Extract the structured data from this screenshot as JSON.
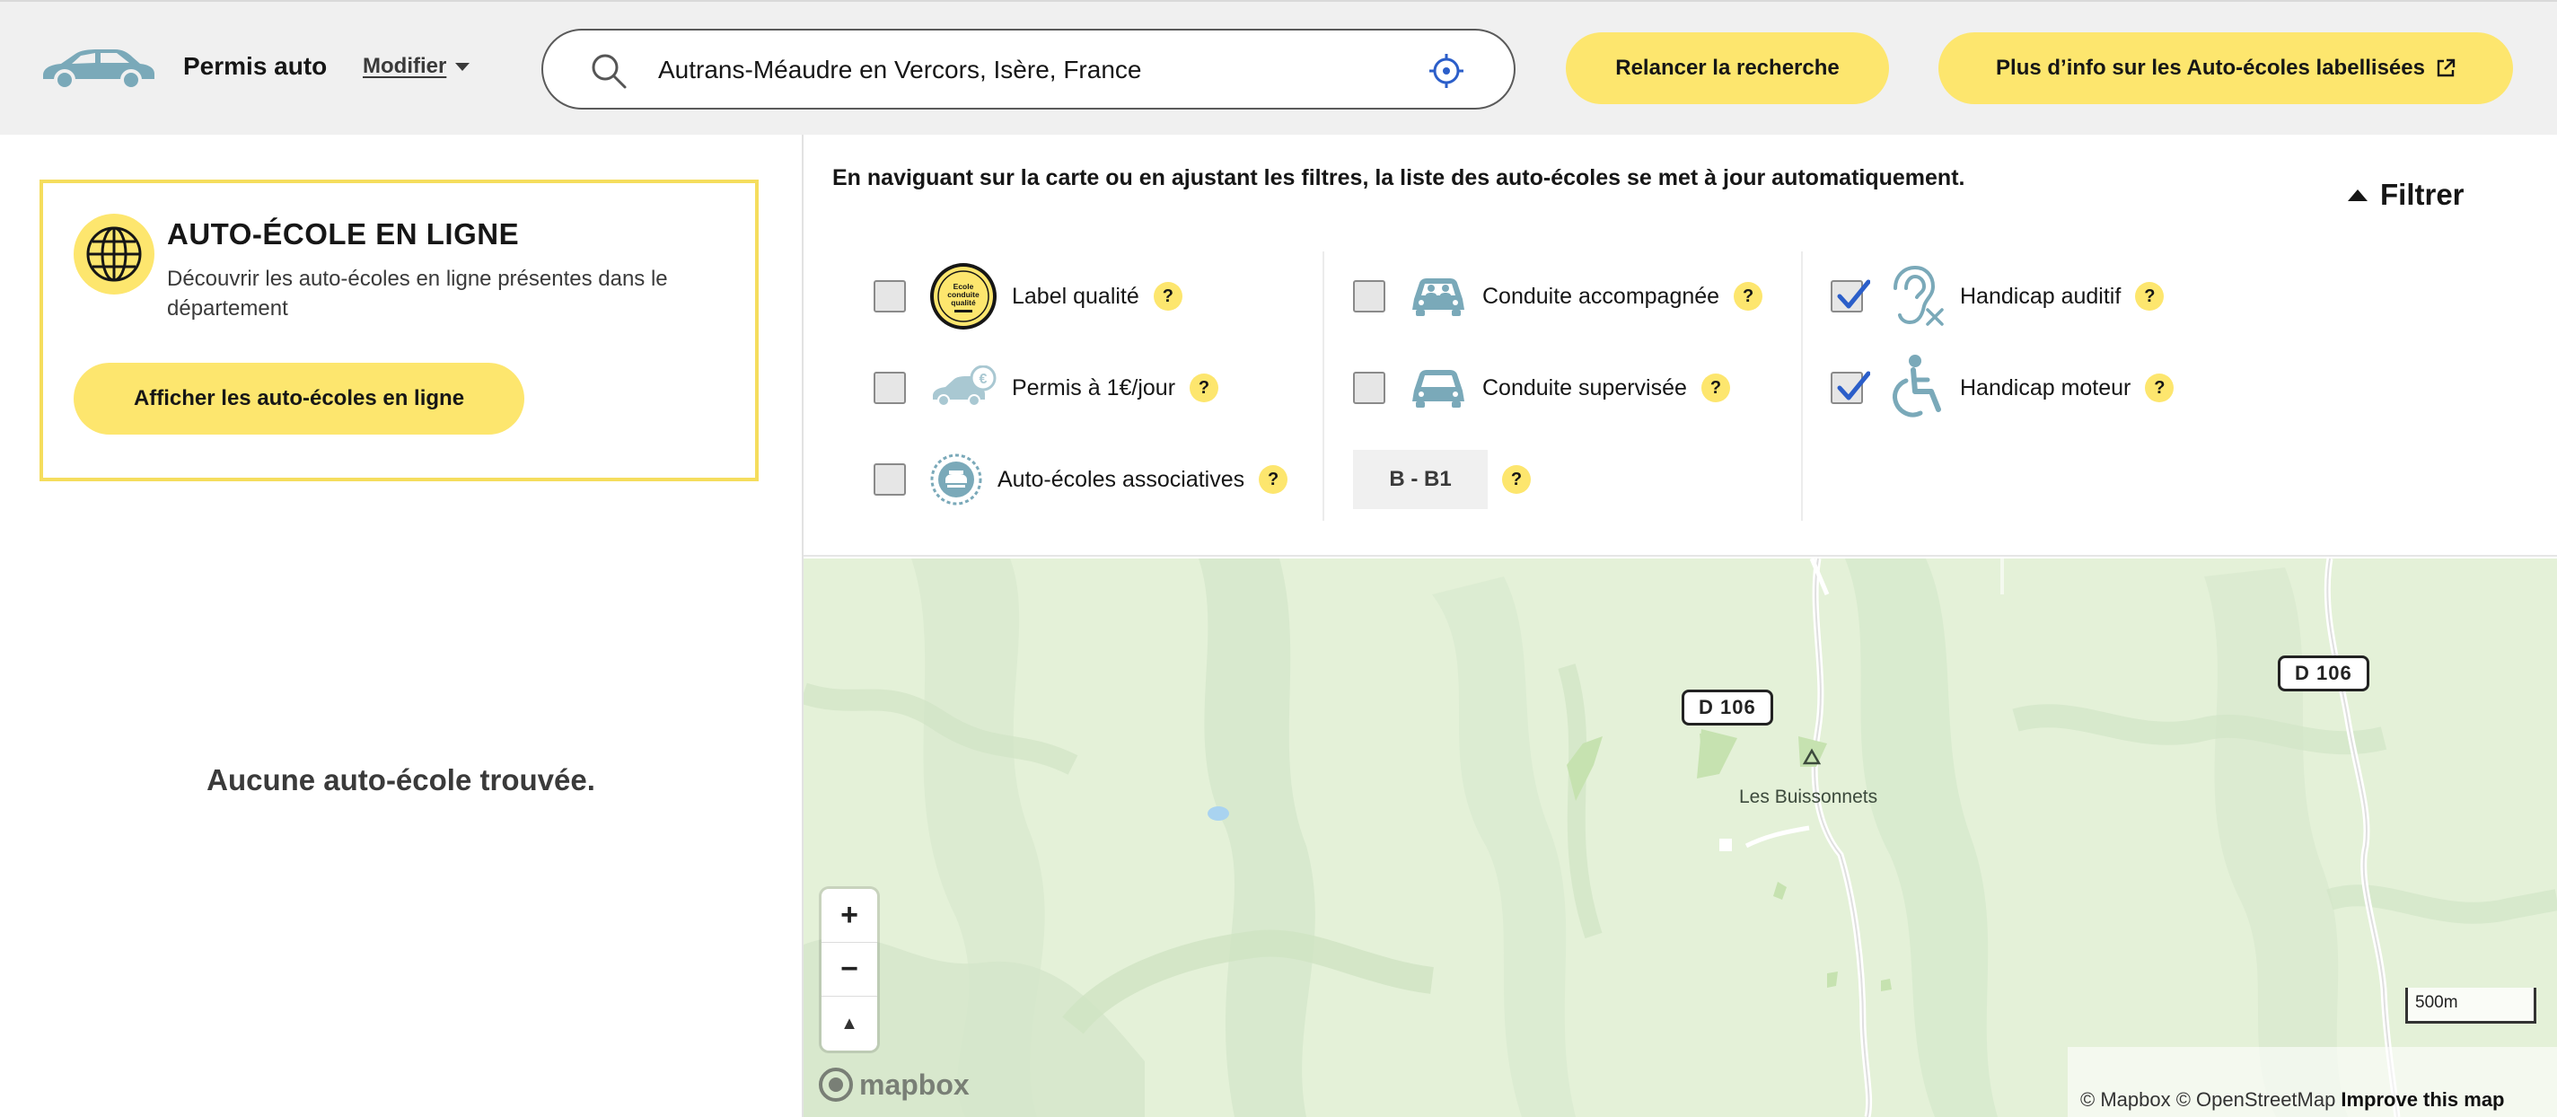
{
  "header": {
    "app_title": "Permis auto",
    "modifier_label": "Modifier",
    "search_value": "Autrans-Méaudre en Vercors, Isère, France",
    "relancer_label": "Relancer la recherche",
    "plus_info_label": "Plus d’info sur les Auto-écoles labellisées"
  },
  "left_panel": {
    "card_title": "AUTO-ÉCOLE EN LIGNE",
    "card_description": "Découvrir les auto-écoles en ligne présentes dans le département",
    "card_button": "Afficher les auto-écoles en ligne",
    "no_result": "Aucune auto-école trouvée."
  },
  "filters": {
    "info": "En naviguant sur la carte ou en ajustant les filtres, la liste des auto-écoles se met à jour automatiquement.",
    "toggle_label": "Filtrer",
    "help_symbol": "?",
    "options": [
      {
        "label": "Label qualité",
        "checked": false,
        "icon": "quality-label-badge-icon"
      },
      {
        "label": "Permis à 1€/jour",
        "checked": false,
        "icon": "car-euro-icon"
      },
      {
        "label": "Auto-écoles associatives",
        "checked": false,
        "icon": "association-icon"
      },
      {
        "label": "Conduite accompagnée",
        "checked": false,
        "icon": "car-passengers-icon"
      },
      {
        "label": "Conduite supervisée",
        "checked": false,
        "icon": "car-icon"
      },
      {
        "label": "Handicap auditif",
        "checked": true,
        "icon": "hearing-impaired-icon"
      },
      {
        "label": "Handicap moteur",
        "checked": true,
        "icon": "wheelchair-icon"
      }
    ],
    "licence_category": "B - B1",
    "badge_text": [
      "Ecole",
      "conduite",
      "qualité"
    ]
  },
  "map": {
    "road_labels": [
      "D 106",
      "D 106"
    ],
    "place_label": "Les Buissonnets",
    "zoom_in": "+",
    "zoom_out": "−",
    "compass": "▲",
    "logo_text": "mapbox",
    "scale": "500m",
    "attribution": "© Mapbox © OpenStreetMap",
    "improve": "Improve this map"
  },
  "colors": {
    "accent_yellow": "#fde66e",
    "card_border": "#f5dd5d",
    "icon_blue": "#6fa3b3",
    "check_blue": "#2b5ec9",
    "map_green": "#e4f1d8"
  }
}
